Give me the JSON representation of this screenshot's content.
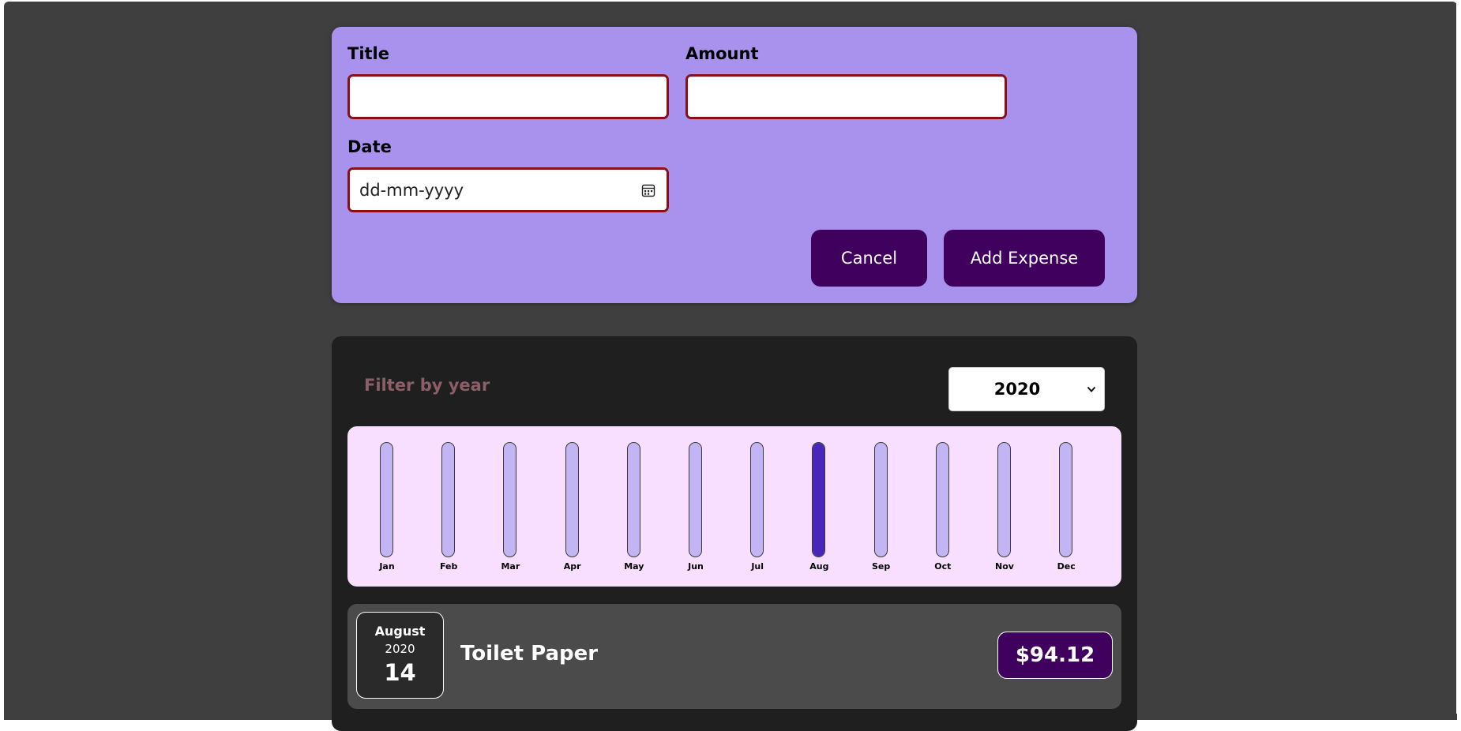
{
  "form": {
    "title_label": "Title",
    "title_value": "",
    "amount_label": "Amount",
    "amount_value": "",
    "date_label": "Date",
    "date_placeholder": "dd-mm-yyyy",
    "cancel_label": "Cancel",
    "add_label": "Add Expense"
  },
  "filter": {
    "label": "Filter by year",
    "selected_year": "2020"
  },
  "chart_data": {
    "type": "bar",
    "categories": [
      "Jan",
      "Feb",
      "Mar",
      "Apr",
      "May",
      "Jun",
      "Jul",
      "Aug",
      "Sep",
      "Oct",
      "Nov",
      "Dec"
    ],
    "values": [
      0,
      0,
      0,
      0,
      0,
      0,
      0,
      94.12,
      0,
      0,
      0,
      0
    ],
    "ylim": [
      0,
      94.12
    ]
  },
  "expenses": [
    {
      "month": "August",
      "year": "2020",
      "day": "14",
      "title": "Toilet Paper",
      "amount": "$94.12"
    }
  ],
  "colors": {
    "form_bg": "#a892ee",
    "button_bg": "#40005d",
    "field_border": "#8b0f17",
    "chart_bg": "#f8dfff",
    "bar_track": "#c3b4f3",
    "bar_fill": "#4826b9"
  }
}
